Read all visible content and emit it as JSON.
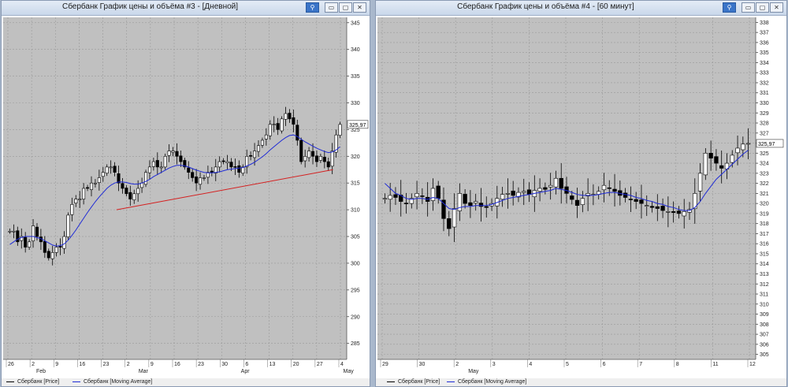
{
  "colors": {
    "candle": "#000000",
    "ma": "#1f2bd6",
    "trend": "#d42020",
    "plot_bg": "#c0c0c0",
    "grid": "#9a9a9a"
  },
  "window_buttons": {
    "pin": "pin-icon",
    "minimize": "minimize-icon",
    "maximize": "maximize-icon",
    "close": "close-icon"
  },
  "windows": [
    {
      "title": "Сбербанк График цены и объёма #3 - [Дневной]",
      "buttons": {
        "pin": "⚲",
        "min": "▭",
        "max": "▢",
        "close": "✕"
      },
      "legend": {
        "price": "Сбербанк [Price]",
        "ma": "Сбербанк [Moving Average]"
      },
      "last_price": "325,97",
      "x_labels": [
        "26",
        "2",
        "9",
        "16",
        "23",
        "2",
        "9",
        "16",
        "23",
        "30",
        "6",
        "13",
        "20",
        "27",
        "4"
      ],
      "month_labels": [
        "Feb",
        "Mar",
        "Apr",
        "May"
      ]
    },
    {
      "title": "Сбербанк График цены и объёма #4 - [60 минут]",
      "buttons": {
        "pin": "⚲",
        "min": "▭",
        "max": "▢",
        "close": "✕"
      },
      "legend": {
        "price": "Сбербанк [Price]",
        "ma": "Сбербанк [Moving Average]"
      },
      "last_price": "325,97",
      "x_labels": [
        "29",
        "30",
        "2",
        "3",
        "4",
        "5",
        "6",
        "7",
        "8",
        "11",
        "12"
      ],
      "month_labels": [
        "May"
      ]
    }
  ],
  "chart_data": [
    {
      "type": "line",
      "subtype": "candlestick",
      "title": "Сбербанк График цены и объёма #3 - [Дневной]",
      "ylim": [
        282,
        346
      ],
      "yticks": [
        285,
        290,
        295,
        300,
        305,
        310,
        315,
        320,
        325,
        330,
        335,
        340,
        345
      ],
      "grid": true,
      "series": [
        {
          "name": "Сбербанк [Price]",
          "close": [
            306,
            306,
            304,
            305,
            303,
            304,
            307,
            305,
            304,
            302,
            301,
            302,
            303,
            303,
            305,
            309,
            311,
            312,
            312,
            314,
            314,
            315,
            315,
            316,
            317,
            318,
            318,
            317,
            315,
            314,
            313,
            312,
            313,
            314,
            315,
            317,
            318,
            319,
            318,
            318,
            320,
            321,
            321,
            320,
            319,
            318,
            317,
            316,
            315,
            316,
            316,
            317,
            317,
            318,
            319,
            319,
            319,
            318,
            318,
            317,
            318,
            320,
            320,
            321,
            322,
            323,
            324,
            326,
            326,
            325,
            327,
            328,
            327,
            326,
            323,
            319,
            320,
            321,
            320,
            319,
            320,
            319,
            318,
            321,
            324,
            325.97
          ]
        },
        {
          "name": "Сбербанк [Moving Average]",
          "values": [
            303.5,
            304,
            304.5,
            304.8,
            305,
            305,
            305,
            304.8,
            304.6,
            304.2,
            303.8,
            303.4,
            303.2,
            303.3,
            303.6,
            304.3,
            305.2,
            306.2,
            307.3,
            308.4,
            309.5,
            310.5,
            311.5,
            312.4,
            313.2,
            314,
            314.6,
            315,
            315.2,
            315.2,
            315.1,
            314.9,
            314.8,
            314.8,
            315,
            315.3,
            315.7,
            316.2,
            316.6,
            317,
            317.4,
            317.8,
            318.1,
            318.3,
            318.3,
            318.2,
            318,
            317.7,
            317.4,
            317.2,
            317,
            316.9,
            316.9,
            317,
            317.1,
            317.3,
            317.5,
            317.6,
            317.7,
            317.8,
            317.9,
            318.2,
            318.5,
            318.9,
            319.4,
            319.9,
            320.5,
            321.2,
            321.8,
            322.4,
            323,
            323.5,
            323.9,
            324,
            323.7,
            323.2,
            322.7,
            322.3,
            321.9,
            321.5,
            321.2,
            320.9,
            320.7,
            320.8,
            321.2,
            321.8
          ]
        },
        {
          "name": "",
          "trendline": [
            310,
            317.5
          ]
        }
      ]
    },
    {
      "type": "line",
      "subtype": "candlestick",
      "title": "Сбербанк График цены и объёма #4 - [60 минут]",
      "ylim": [
        304.5,
        338.5
      ],
      "yticks": [
        305,
        306,
        307,
        308,
        309,
        310,
        311,
        312,
        313,
        314,
        315,
        316,
        317,
        318,
        319,
        320,
        321,
        322,
        323,
        324,
        325,
        326,
        327,
        328,
        329,
        330,
        331,
        332,
        333,
        334,
        335,
        336,
        337,
        338
      ],
      "grid": true,
      "series": [
        {
          "name": "Сбербанк [Price]",
          "close": [
            320.5,
            320.8,
            320.6,
            320.2,
            320,
            320.5,
            321,
            320.7,
            320.2,
            321.5,
            320.5,
            318.5,
            317.5,
            319.5,
            321,
            320,
            319.8,
            320.2,
            319.7,
            319.6,
            320,
            320.5,
            320.9,
            321,
            320.8,
            321.1,
            321.2,
            320.9,
            321.3,
            321.5,
            321.4,
            321.8,
            322.5,
            321.5,
            321,
            320.4,
            319.8,
            320.5,
            321,
            320.9,
            321.2,
            321.8,
            321.5,
            321.2,
            320.8,
            320.6,
            320.4,
            320.2,
            320,
            319.8,
            319.6,
            319.5,
            319.3,
            319.2,
            319.1,
            319,
            319.2,
            319.4,
            321,
            323,
            325,
            324.5,
            324,
            323.5,
            324,
            324.8,
            325.5,
            325.9,
            325.97
          ]
        },
        {
          "name": "Сбербанк [Moving Average]",
          "values": [
            322,
            321.5,
            321,
            320.8,
            320.5,
            320.4,
            320.5,
            320.5,
            320.4,
            320.6,
            320.5,
            320,
            319.5,
            319.4,
            319.6,
            319.7,
            319.7,
            319.8,
            319.8,
            319.8,
            319.9,
            320.1,
            320.3,
            320.5,
            320.6,
            320.7,
            320.8,
            320.9,
            321,
            321.1,
            321.2,
            321.3,
            321.5,
            321.4,
            321.3,
            321.1,
            320.9,
            320.8,
            320.8,
            320.8,
            320.9,
            321,
            321.1,
            321.1,
            321,
            320.9,
            320.8,
            320.6,
            320.5,
            320.3,
            320.2,
            320,
            319.9,
            319.7,
            319.6,
            319.4,
            319.3,
            319.3,
            319.6,
            320.2,
            321,
            321.7,
            322.4,
            322.9,
            323.4,
            323.9,
            324.4,
            324.9,
            325.3
          ]
        }
      ]
    }
  ]
}
